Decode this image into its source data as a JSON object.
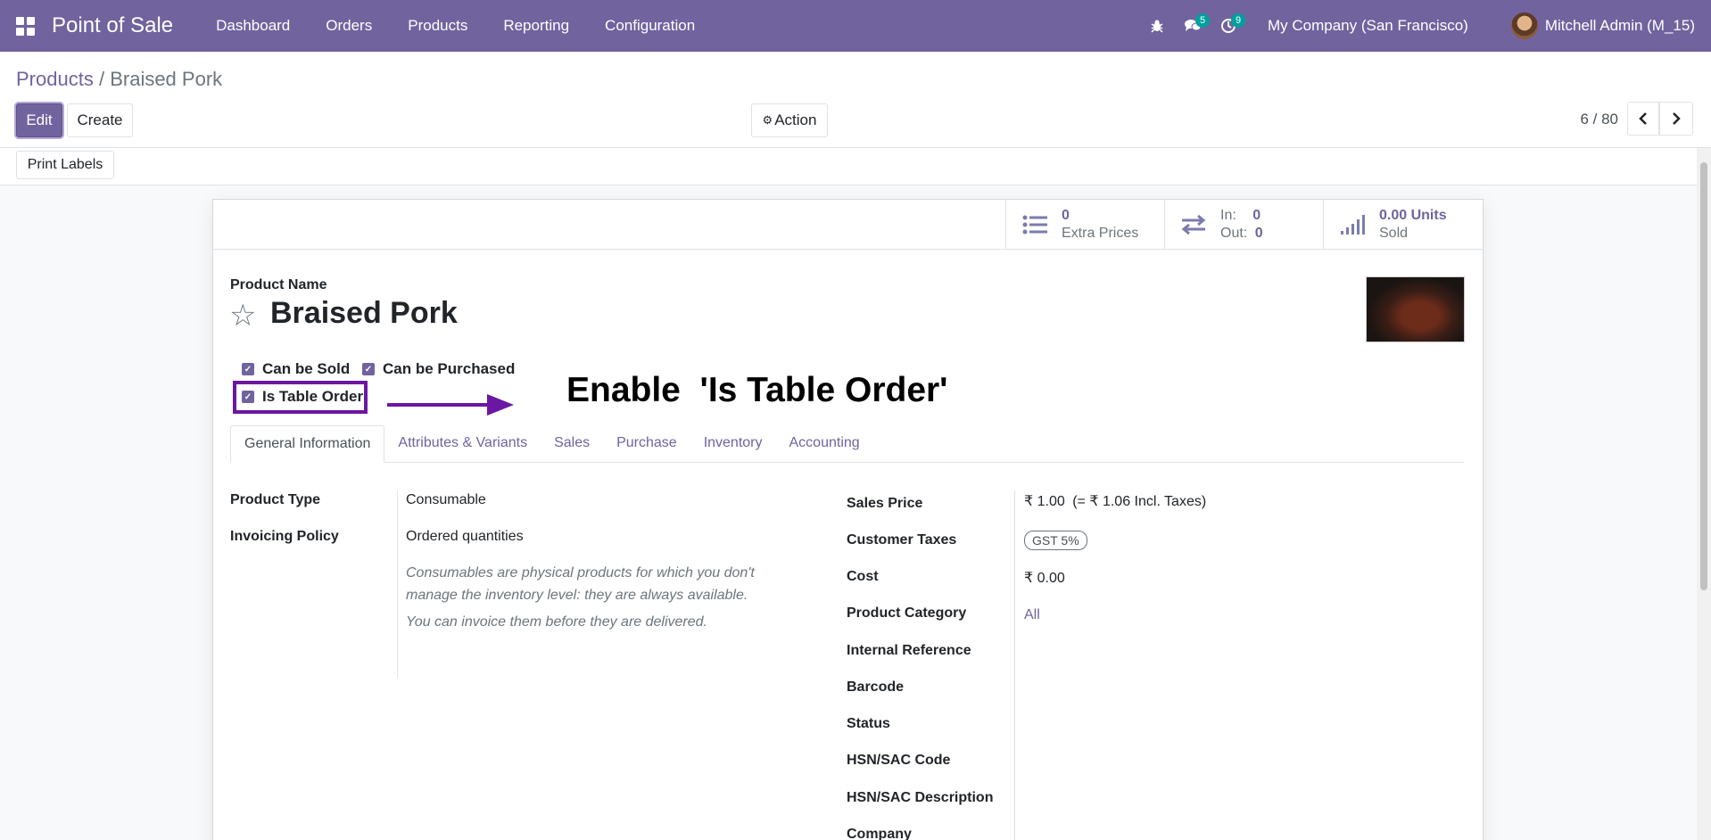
{
  "navbar": {
    "app_name": "Point of Sale",
    "menu": [
      "Dashboard",
      "Orders",
      "Products",
      "Reporting",
      "Configuration"
    ],
    "messages_badge": "5",
    "activities_badge": "9",
    "company": "My Company (San Francisco)",
    "user": "Mitchell Admin (M_15)",
    "color": "#71639e"
  },
  "breadcrumb": {
    "parent": "Products",
    "separator": "/",
    "current": "Braised Pork"
  },
  "toolbar": {
    "edit_label": "Edit",
    "create_label": "Create",
    "action_label": "Action",
    "pager": "6 / 80"
  },
  "statusbar": {
    "print_labels": "Print Labels"
  },
  "smart_buttons": [
    {
      "icon": "list-icon",
      "value": "0",
      "label": "Extra Prices"
    },
    {
      "icon": "transfer-icon",
      "in_label": "In:",
      "in_value": "0",
      "out_label": "Out:",
      "out_value": "0"
    },
    {
      "icon": "signal-icon",
      "value": "0.00 Units",
      "label": "Sold"
    }
  ],
  "product": {
    "name_label": "Product Name",
    "name": "Braised Pork",
    "can_be_sold": "Can be Sold",
    "can_be_purchased": "Can be Purchased",
    "is_table_order": "Is Table Order"
  },
  "annotation": "Enable  'Is Table Order'",
  "tabs": [
    "General Information",
    "Attributes & Variants",
    "Sales",
    "Purchase",
    "Inventory",
    "Accounting"
  ],
  "left_fields": {
    "product_type_label": "Product Type",
    "product_type": "Consumable",
    "invoicing_policy_label": "Invoicing Policy",
    "invoicing_policy": "Ordered quantities",
    "help_line1": "Consumables are physical products for which you don't",
    "help_line2": "manage the inventory level: they are always available.",
    "help_line3": "You can invoice them before they are delivered."
  },
  "right_fields": {
    "sales_price_label": "Sales Price",
    "sales_price": "₹ 1.00",
    "sales_price_incl": "(= ₹ 1.06 Incl. Taxes)",
    "customer_taxes_label": "Customer Taxes",
    "customer_taxes": "GST 5%",
    "cost_label": "Cost",
    "cost": "₹ 0.00",
    "category_label": "Product Category",
    "category": "All",
    "internal_ref_label": "Internal Reference",
    "barcode_label": "Barcode",
    "status_label": "Status",
    "hsn_code_label": "HSN/SAC Code",
    "hsn_desc_label": "HSN/SAC Description",
    "company_label": "Company"
  }
}
